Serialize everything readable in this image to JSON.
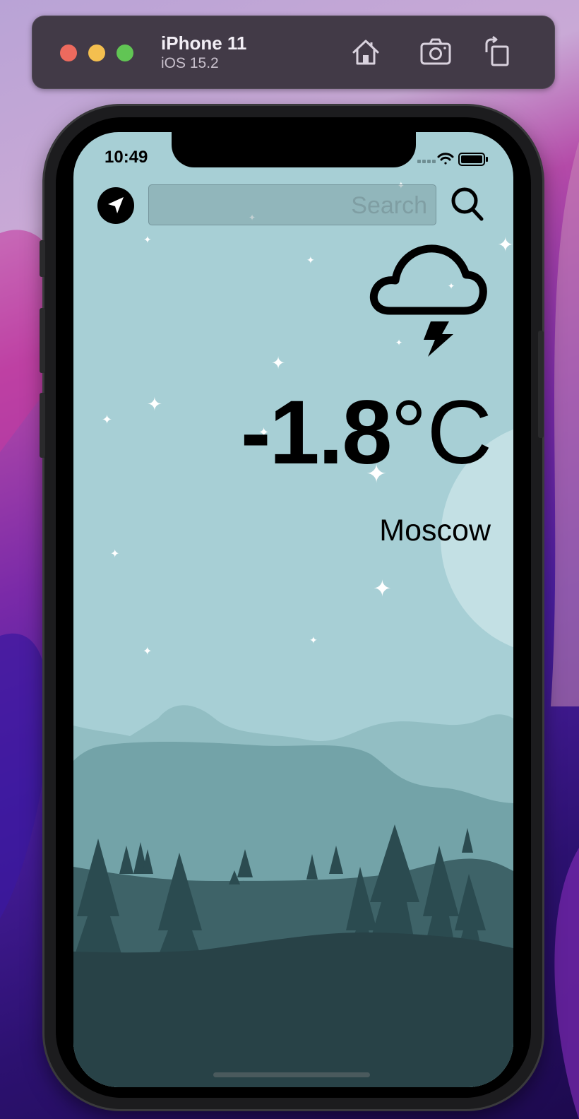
{
  "toolbar": {
    "device_name": "iPhone 11",
    "os_version": "iOS 15.2",
    "buttons": [
      "home-icon",
      "screenshot-icon",
      "rotate-icon"
    ]
  },
  "status_bar": {
    "time": "10:49",
    "icons": [
      "cellular-icon",
      "wifi-icon",
      "battery-icon"
    ]
  },
  "search": {
    "placeholder": "Search",
    "value": ""
  },
  "weather": {
    "condition_icon": "cloud-bolt-icon",
    "temperature": "-1.8",
    "unit": "°C",
    "city": "Moscow"
  },
  "colors": {
    "sky": "#a7cfd5",
    "moon": "#c3e0e4",
    "hill_light": "#92bec3",
    "hill_mid": "#73a3a8",
    "forest": "#3e6368",
    "ground": "#284247",
    "trees": "#2b4b50"
  }
}
